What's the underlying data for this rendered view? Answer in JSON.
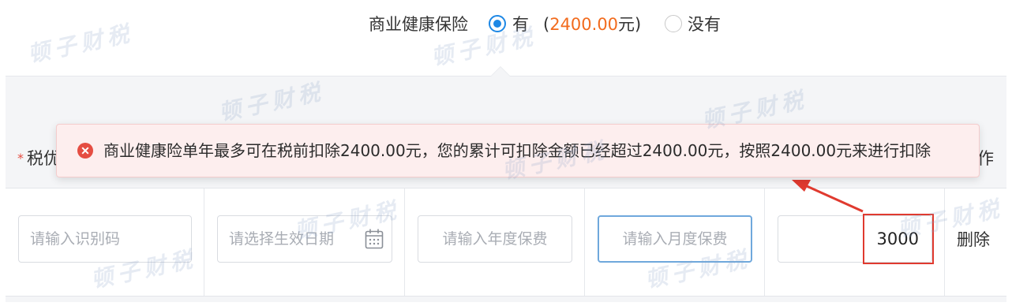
{
  "insurance": {
    "label": "商业健康保险",
    "option_yes": "有",
    "amount_open": "(",
    "amount_value": "2400.00",
    "amount_unit": "元)",
    "option_no": "没有",
    "selected": "有"
  },
  "table": {
    "header_left_partial": "税优",
    "header_required_mark": "*",
    "header_right_partial": "作"
  },
  "row": {
    "id_placeholder": "请输入识别码",
    "date_placeholder": "请选择生效日期",
    "annual_placeholder": "请输入年度保费",
    "monthly_placeholder": "请输入月度保费",
    "amount_value": "3000",
    "delete_label": "删除"
  },
  "alert": {
    "message": "商业健康险单年最多可在税前扣除2400.00元，您的累计可扣除金额已经超过2400.00元，按照2400.00元来进行扣除"
  },
  "watermark": {
    "text": "顿子财税"
  },
  "colors": {
    "accent": "#1e88e5",
    "amount": "#f26b1d",
    "error": "#e54d42",
    "annotation": "#e03a2f"
  }
}
